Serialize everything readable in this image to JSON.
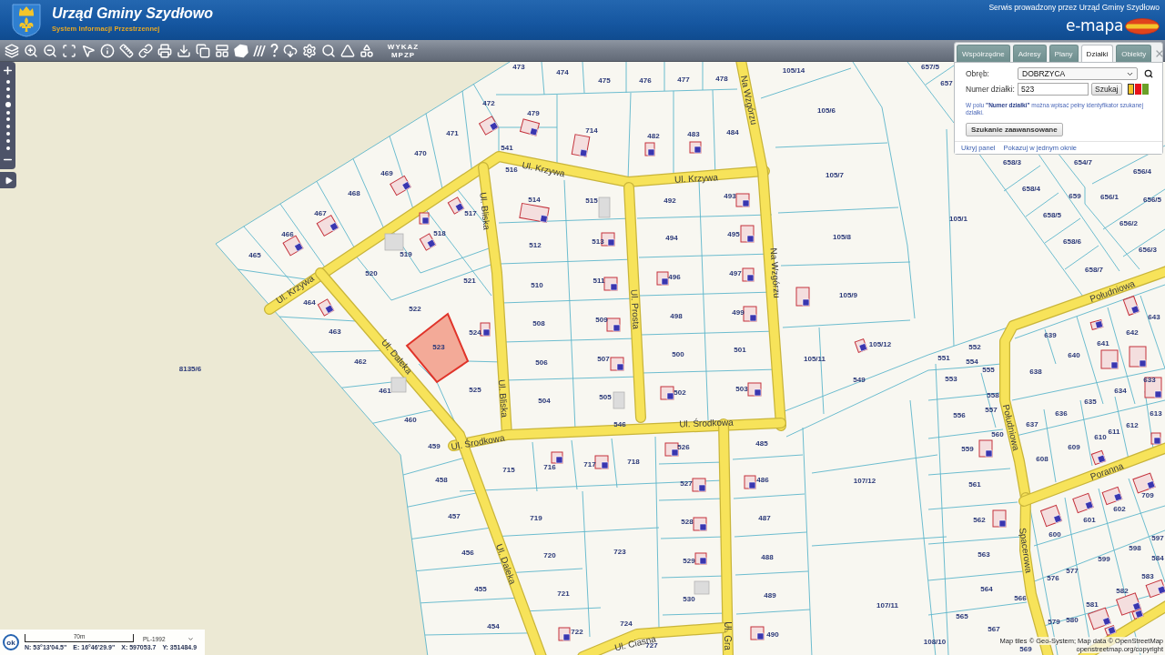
{
  "header": {
    "title": "Urząd Gminy Szydłowo",
    "subtitle": "System Informacji Przestrzennej",
    "service_note": "Serwis prowadzony przez Urząd Gminy Szydłowo",
    "brand": "e-mapa"
  },
  "toolbar": {
    "list_button": "WYKAZ MPZP"
  },
  "zoom_bar": {
    "levels": [
      {
        "selected": false
      },
      {
        "selected": false
      },
      {
        "selected": false
      },
      {
        "selected": true
      },
      {
        "selected": false
      },
      {
        "selected": false
      },
      {
        "selected": false
      },
      {
        "selected": false
      },
      {
        "selected": false
      },
      {
        "selected": false
      }
    ]
  },
  "search_panel": {
    "tabs": [
      {
        "label": "Współrzędne",
        "selected": false
      },
      {
        "label": "Adresy",
        "selected": false
      },
      {
        "label": "Plany",
        "selected": false
      },
      {
        "label": "Działki",
        "selected": true
      },
      {
        "label": "Obiekty",
        "selected": false
      }
    ],
    "precinct_label": "Obręb:",
    "precinct_value": "DOBRZYCA",
    "parcel_label": "Numer działki:",
    "parcel_value": "523",
    "search_button": "Szukaj",
    "highlight_colors": [
      {
        "color": "#f2c428",
        "selected": true
      },
      {
        "color": "#e8141c",
        "selected": false
      },
      {
        "color": "#6aa028",
        "selected": false
      }
    ],
    "hint": "W polu **\"Numer działki\"** można wpisać pełny identyfikator szukanej działki.",
    "advanced_button": "Szukanie zaawansowane",
    "links": [
      "Ukryj panel",
      "Pokazuj w jednym oknie"
    ]
  },
  "map": {
    "highlighted_parcel": "523",
    "parcels": [
      "473",
      "474",
      "105/14",
      "657/5",
      "475",
      "476",
      "477",
      "478",
      "657",
      "472",
      "479",
      "105/6",
      "471",
      "714",
      "482",
      "483",
      "484",
      "470",
      "541",
      "658/3",
      "654/7",
      "469",
      "516",
      "105/7",
      "656/4",
      "468",
      "658/4",
      "514",
      "515",
      "492",
      "493",
      "659",
      "656/1",
      "656/5",
      "467",
      "517",
      "105/1",
      "658/5",
      "656/2",
      "466",
      "518",
      "494",
      "495",
      "105/8",
      "512",
      "513",
      "658/6",
      "465",
      "519",
      "656/3",
      "520",
      "496",
      "497",
      "658/7",
      "521",
      "510",
      "511",
      "105/9",
      "464",
      "522",
      "508",
      "509",
      "498",
      "499",
      "643",
      "463",
      "524",
      "639",
      "642",
      "501",
      "105/12",
      "552",
      "641",
      "462",
      "506",
      "507",
      "500",
      "105/11",
      "551",
      "554",
      "640",
      "8135/6",
      "555",
      "638",
      "549",
      "553",
      "633",
      "461",
      "525",
      "505",
      "502",
      "503",
      "558",
      "634",
      "504",
      "635",
      "556",
      "557",
      "636",
      "613",
      "460",
      "546",
      "637",
      "612",
      "560",
      "610",
      "611",
      "459",
      "526",
      "485",
      "559",
      "609",
      "715",
      "716",
      "717",
      "718",
      "608",
      "458",
      "527",
      "486",
      "107/12",
      "561",
      "709",
      "602",
      "457",
      "719",
      "528",
      "487",
      "562",
      "601",
      "600",
      "597",
      "456",
      "720",
      "723",
      "563",
      "598",
      "529",
      "488",
      "599",
      "584",
      "576",
      "577",
      "583",
      "455",
      "721",
      "530",
      "489",
      "564",
      "566",
      "582",
      "107/11",
      "581",
      "724",
      "565",
      "579",
      "580",
      "454",
      "722",
      "490",
      "567",
      "727",
      "108/10",
      "569"
    ],
    "streets": [
      "Ul. Krzywa",
      "Ul. Krzywa",
      "Ul. Krzywa",
      "Ul. Bliska",
      "Ul. Bliska",
      "Na Wzgórzu",
      "Na Wzgórzu",
      "Ul. Prosta",
      "Ul. Daleka",
      "Ul. Daleka",
      "Ul. Środkowa",
      "Ul. Środkowa",
      "Ul. Ciasna",
      "Południowa",
      "Południowa",
      "Poranna",
      "Spacerowa",
      "Ul. Gra"
    ]
  },
  "status_bar": {
    "ok_button": "ok",
    "scale": "70m",
    "projection": "PL-1992",
    "coordinates": [
      "N: 53°13'04.5\"",
      "E: 16°46'29.9\"",
      "X: 597053.7",
      "Y: 351484.9"
    ]
  },
  "attribution": [
    "Map tiles © Geo-System; Map data © OpenStreetMap",
    "openstreetmap.org/copyright"
  ]
}
